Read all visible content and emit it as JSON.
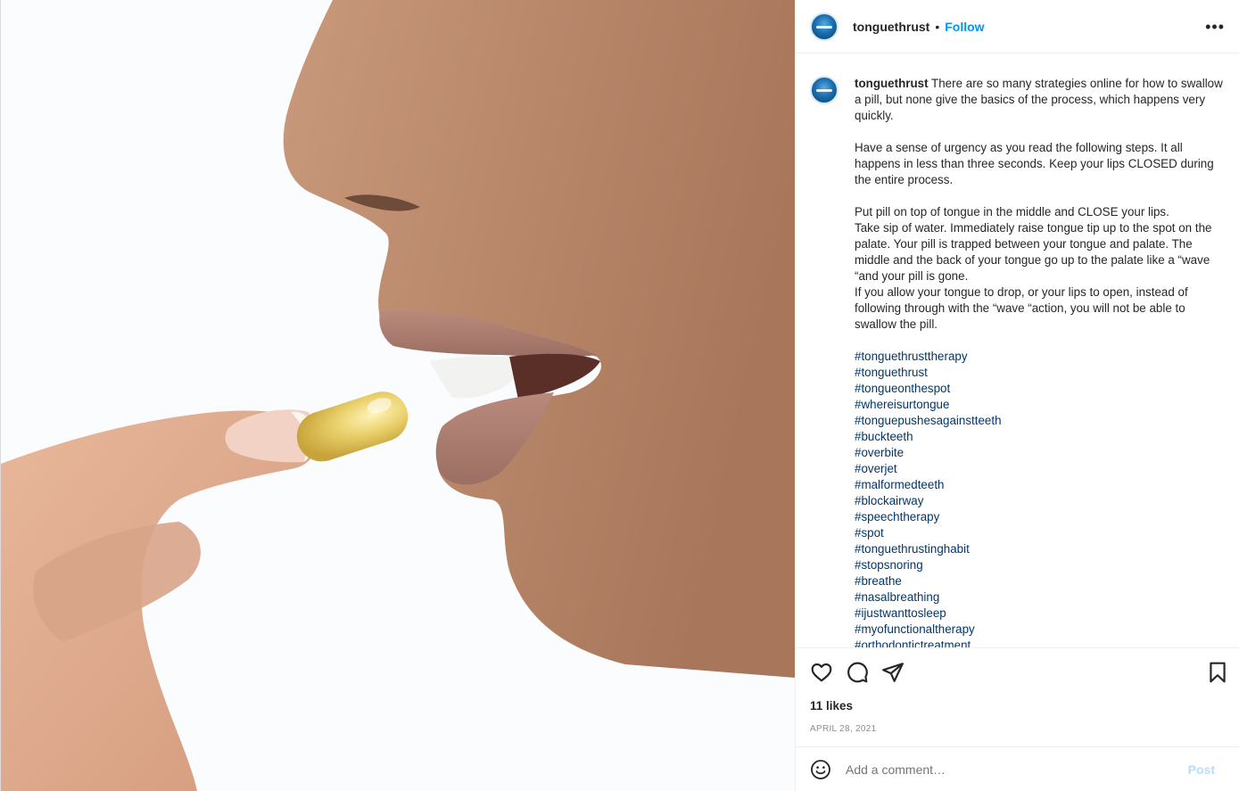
{
  "post": {
    "username": "tonguethrust",
    "separator": "•",
    "follow_label": "Follow",
    "more_label": "•••",
    "image_alt": "Person placing a gel capsule pill into mouth"
  },
  "caption": {
    "username": "tonguethrust",
    "paragraphs": [
      "There are so many strategies online for how to swallow a pill, but none give the basics of the process, which happens very quickly.",
      "Have a sense of urgency as you read the following steps. It all happens in less than three seconds. Keep your lips CLOSED during the entire process.",
      "Put pill on top of tongue in the middle and CLOSE your lips.",
      "Take sip of water. Immediately raise tongue tip up to the spot on the palate. Your pill is trapped between your tongue and palate. The middle and the back of your tongue go up to the palate like a “wave “and your pill is gone.",
      "If you allow your tongue to drop, or your lips to open, instead of following through with the “wave “action, you will not be able to swallow the pill."
    ],
    "hashtags": [
      "#tonguethrusttherapy",
      "#tonguethrust",
      "#tongueonthespot",
      "#whereisurtongue",
      "#tonguepushesagainstteeth",
      "#buckteeth",
      "#overbite",
      "#overjet",
      "#malformedteeth",
      "#blockairway",
      "#speechtherapy",
      "#spot",
      "#tonguethrustinghabit",
      "#stopsnoring",
      "#breathe",
      "#nasalbreathing",
      "#ijustwanttosleep",
      "#myofunctionaltherapy",
      "#orthodontictreatment"
    ]
  },
  "stats": {
    "likes": "11 likes",
    "date": "APRIL 28, 2021"
  },
  "comment_box": {
    "placeholder": "Add a comment…",
    "post_label": "Post"
  },
  "icons": {
    "like": "heart-icon",
    "comment": "comment-bubble-icon",
    "share": "paper-plane-icon",
    "save": "bookmark-icon",
    "emoji": "smiley-icon",
    "more": "ellipsis-icon"
  },
  "colors": {
    "accent": "#0095f6",
    "hashtag": "#00376b",
    "muted": "#8e8e8e",
    "post_disabled": "#b2dffc"
  }
}
